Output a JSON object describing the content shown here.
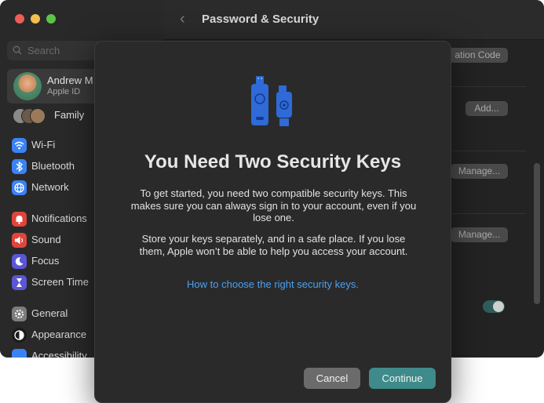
{
  "window": {
    "traffic_lights": {
      "close": "#ee5e56",
      "minimize": "#f5bd4f",
      "zoom": "#5bc448"
    }
  },
  "sidebar": {
    "search_placeholder": "Search",
    "account": {
      "name": "Andrew M",
      "subtitle": "Apple ID"
    },
    "family_label": "Family",
    "items": [
      {
        "label": "Wi-Fi",
        "icon": "wifi-icon",
        "color": "#3b82f6"
      },
      {
        "label": "Bluetooth",
        "icon": "bluetooth-icon",
        "color": "#3b82f6"
      },
      {
        "label": "Network",
        "icon": "globe-icon",
        "color": "#3b82f6"
      },
      {
        "label": "Notifications",
        "icon": "bell-icon",
        "color": "#e0453c"
      },
      {
        "label": "Sound",
        "icon": "speaker-icon",
        "color": "#e0453c"
      },
      {
        "label": "Focus",
        "icon": "moon-icon",
        "color": "#5a56d6"
      },
      {
        "label": "Screen Time",
        "icon": "hourglass-icon",
        "color": "#5a56d6"
      },
      {
        "label": "General",
        "icon": "gear-icon",
        "color": "#7c7c7c"
      },
      {
        "label": "Appearance",
        "icon": "appearance-icon",
        "color": "#1c1c1c"
      },
      {
        "label": "Accessibility",
        "icon": "accessibility-icon",
        "color": "#3b82f6"
      }
    ]
  },
  "header": {
    "title": "Password & Security"
  },
  "background_buttons": {
    "verification_code": "ation Code",
    "add": "Add...",
    "manage_1": "Manage...",
    "manage_2": "Manage..."
  },
  "dialog": {
    "icon": "security-keys-icon",
    "title": "You Need Two Security Keys",
    "paragraph_1": "To get started, you need two compatible security keys. This makes sure you can always sign in to your account, even if you lose one.",
    "paragraph_2": "Store your keys separately, and in a safe place. If you lose them, Apple won’t be able to help you access your account.",
    "link": "How to choose the right security keys.",
    "cancel_label": "Cancel",
    "continue_label": "Continue",
    "accent_color": "#3f8a8a",
    "link_color": "#4ba0f0"
  }
}
